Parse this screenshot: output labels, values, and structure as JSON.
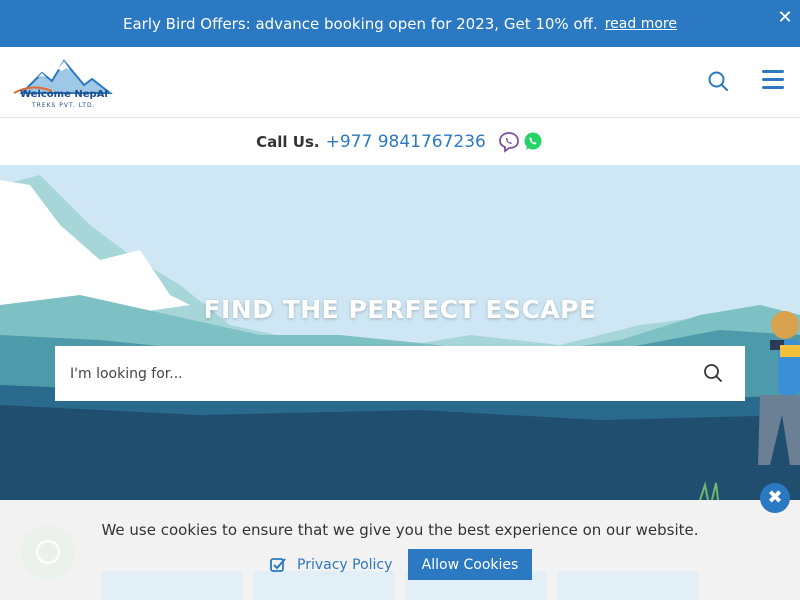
{
  "offer_bar": {
    "text": "Early Bird Offers: advance booking open for 2023, Get 10% off.",
    "link": "read more",
    "close": "✕"
  },
  "header": {
    "logo_name": "Welcome NepAl",
    "logo_sub": "TREKS PVT. LTD."
  },
  "callbar": {
    "label": "Call Us.",
    "phone": "+977 9841767236"
  },
  "hero": {
    "title": "FIND THE PERFECT ESCAPE",
    "search_placeholder": "I'm looking for..."
  },
  "cookie": {
    "text": "We use cookies to ensure that we give you the best experience on our website.",
    "privacy_label": "Privacy Policy",
    "allow_label": "Allow Cookies",
    "close": "✖"
  },
  "colors": {
    "brand_blue": "#2b79c2",
    "sky": "#cfe7f4",
    "viber": "#7b519d",
    "whatsapp": "#25d366"
  }
}
